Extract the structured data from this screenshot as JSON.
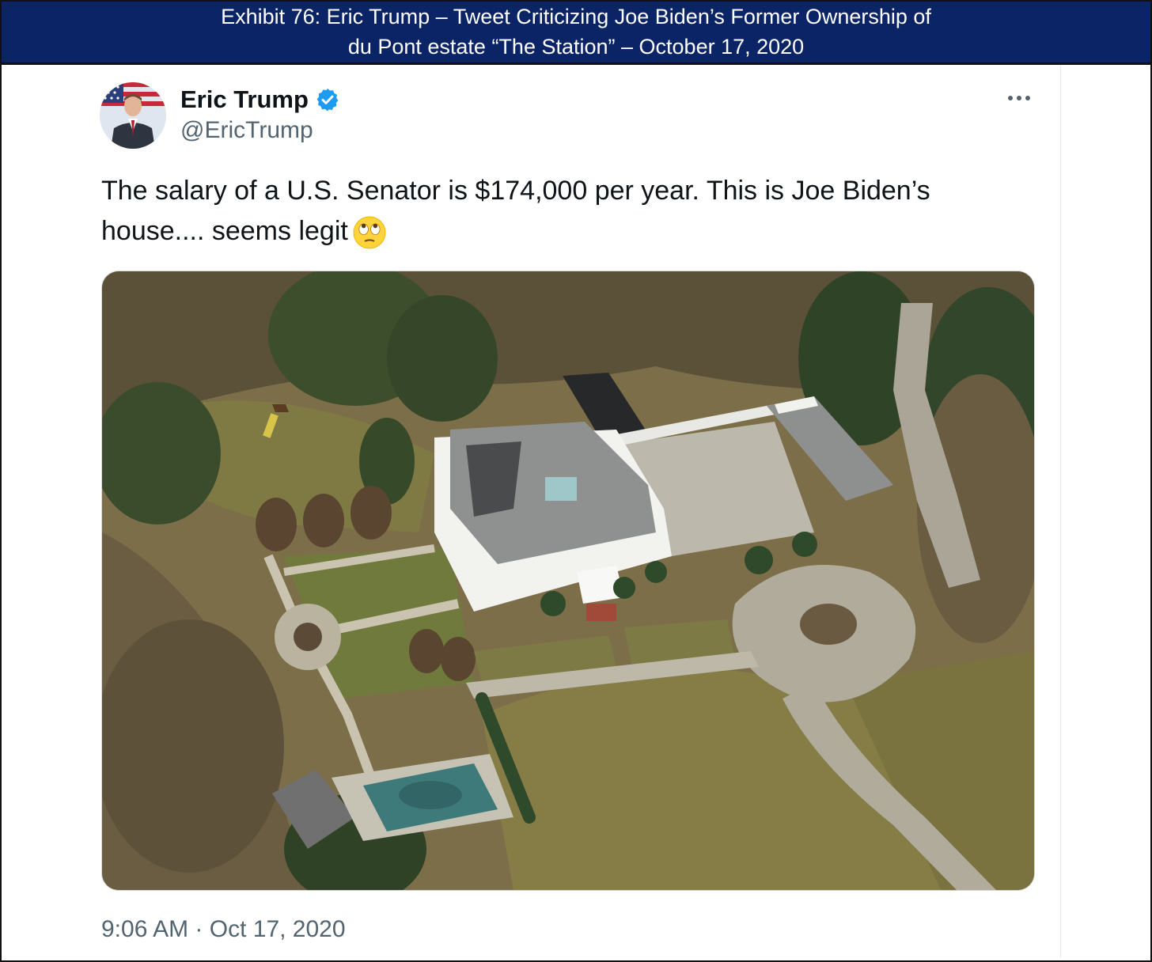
{
  "exhibit": {
    "line1": "Exhibit 76: Eric Trump – Tweet Criticizing Joe Biden’s Former Ownership of",
    "line2": "du Pont estate “The Station” – October 17, 2020"
  },
  "tweet": {
    "display_name": "Eric Trump",
    "handle": "@EricTrump",
    "text": "The salary of a U.S. Senator is $174,000 per year. This is Joe Biden’s house.... seems legit",
    "emoji": "face-with-rolling-eyes",
    "time": "9:06 AM",
    "separator": "·",
    "date": "Oct 17, 2020",
    "media_description_icon": "aerial-photo-of-estate"
  },
  "colors": {
    "header_bg": "#0b2466",
    "verified_blue": "#1d9bf0",
    "secondary_text": "#536471",
    "primary_text": "#0f1419"
  }
}
